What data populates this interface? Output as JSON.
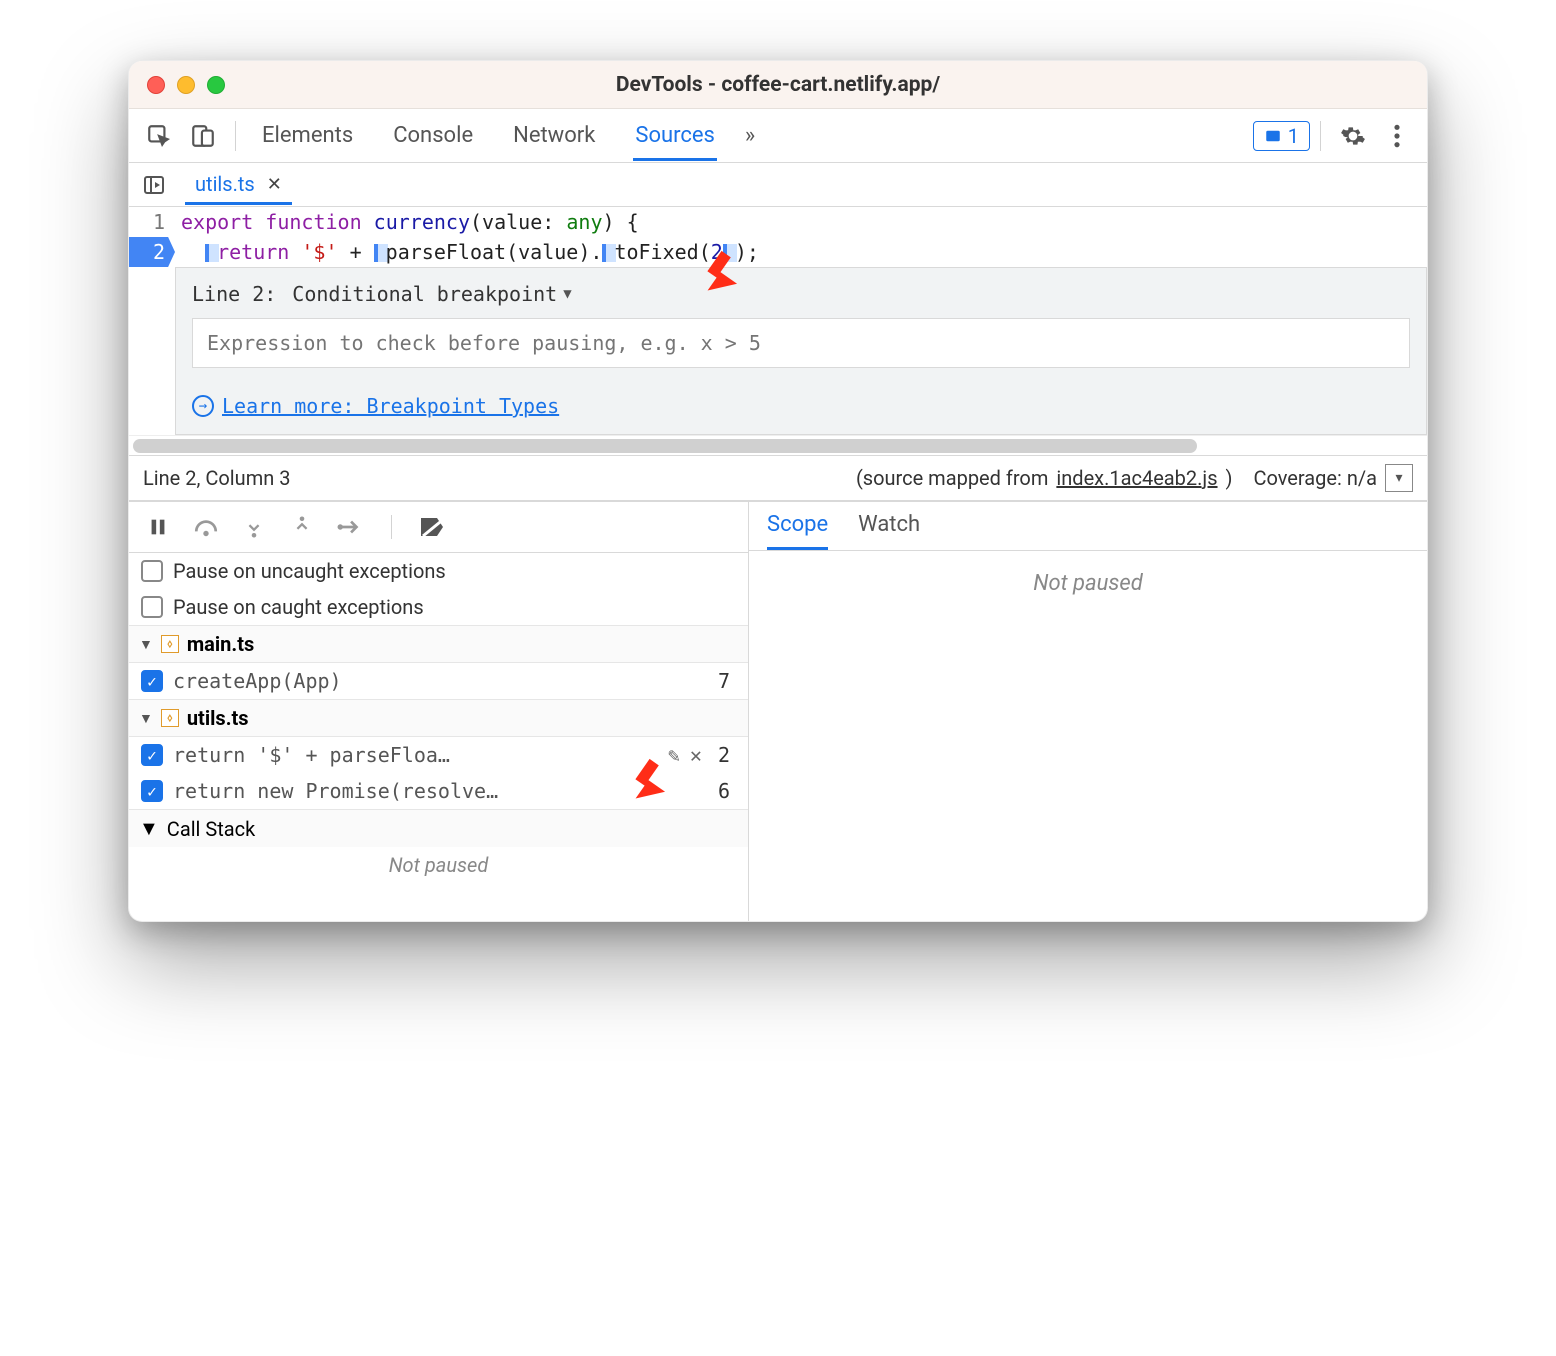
{
  "window": {
    "title": "DevTools - coffee-cart.netlify.app/"
  },
  "tabs": {
    "panels": [
      "Elements",
      "Console",
      "Network",
      "Sources"
    ],
    "active": "Sources",
    "issues_count": "1"
  },
  "file_tab": {
    "name": "utils.ts"
  },
  "code": {
    "line1_tokens": {
      "export": "export",
      "function": "function",
      "name": "currency",
      "lparen": "(",
      "param": "value",
      "colon": ":",
      "type": "any",
      "rparen": ")",
      "brace": "{"
    },
    "line2_tokens": {
      "return": "return",
      "str": "'$'",
      "plus": "+",
      "parseFloat": "parseFloat",
      "l": "(",
      "val": "value",
      "r": ")",
      "dot": ".",
      "toFixed": "toFixed",
      "l2": "(",
      "two": "2",
      "r2": ")",
      "semi": ";"
    },
    "gutter": {
      "l1": "1",
      "l2": "2"
    }
  },
  "bp_editor": {
    "line_label": "Line 2:",
    "type_label": "Conditional breakpoint",
    "placeholder": "Expression to check before pausing, e.g. x > 5",
    "learn_more": "Learn more: Breakpoint Types"
  },
  "statusbar": {
    "pos": "Line 2, Column 3",
    "mapped_prefix": "(source mapped from ",
    "mapped_file": "index.1ac4eab2.js",
    "mapped_suffix": ")",
    "coverage": "Coverage: n/a"
  },
  "exceptions": {
    "uncaught": "Pause on uncaught exceptions",
    "caught": "Pause on caught exceptions"
  },
  "bp_groups": [
    {
      "file": "main.ts",
      "items": [
        {
          "text": "createApp(App)",
          "line": "7",
          "checked": true,
          "hover": false
        }
      ]
    },
    {
      "file": "utils.ts",
      "items": [
        {
          "text": "return '$' + parseFloa…",
          "line": "2",
          "checked": true,
          "hover": true
        },
        {
          "text": "return new Promise(resolve…",
          "line": "6",
          "checked": true,
          "hover": false
        }
      ]
    }
  ],
  "callstack": {
    "label": "Call Stack",
    "not_paused": "Not paused"
  },
  "right_tabs": {
    "scope": "Scope",
    "watch": "Watch",
    "not_paused": "Not paused"
  }
}
